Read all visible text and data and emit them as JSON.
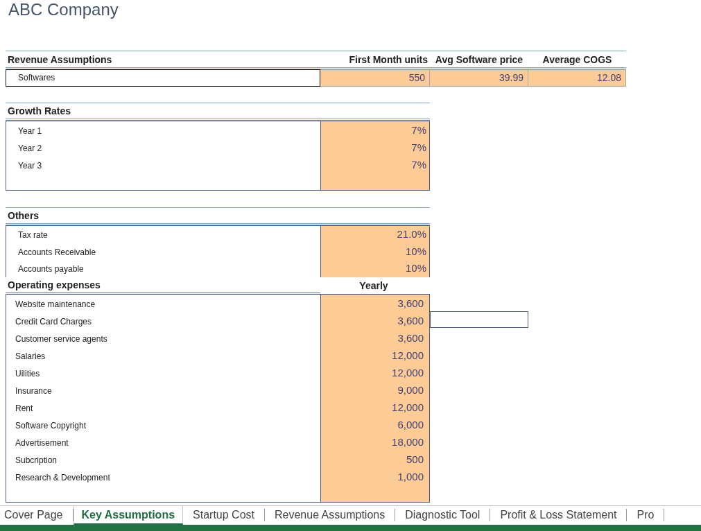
{
  "title": "ABC Company",
  "revenue": {
    "heading": "Revenue Assumptions",
    "columns": [
      "First Month units",
      "Avg Software price",
      "Average COGS"
    ],
    "rows": [
      {
        "label": "Softwares",
        "values": [
          "550",
          "39.99",
          "12.08"
        ]
      }
    ]
  },
  "growth": {
    "heading": "Growth Rates",
    "rows": [
      {
        "label": "Year 1",
        "value": "7%"
      },
      {
        "label": "Year 2",
        "value": "7%"
      },
      {
        "label": "Year 3",
        "value": "7%"
      }
    ]
  },
  "others": {
    "heading": "Others",
    "rows": [
      {
        "label": "Tax rate",
        "value": "21.0%"
      },
      {
        "label": "Accounts Receivable",
        "value": "10%"
      },
      {
        "label": "Accounts payable",
        "value": "10%"
      }
    ]
  },
  "opex": {
    "heading": "Operating expenses",
    "column": "Yearly",
    "rows": [
      {
        "label": "Website maintenance",
        "value": "3,600"
      },
      {
        "label": "Credit Card Charges",
        "value": "3,600"
      },
      {
        "label": "Customer service agents",
        "value": "3,600"
      },
      {
        "label": "Salaries",
        "value": "12,000"
      },
      {
        "label": "Uilities",
        "value": "12,000"
      },
      {
        "label": "Insurance",
        "value": "9,000"
      },
      {
        "label": "Rent",
        "value": "12,000"
      },
      {
        "label": "Software Copyright",
        "value": "6,000"
      },
      {
        "label": "Advertisement",
        "value": "18,000"
      },
      {
        "label": "Subcription",
        "value": "500"
      },
      {
        "label": "Research & Development",
        "value": "1,000"
      }
    ]
  },
  "sheet_tabs": [
    {
      "label": "Cover Page",
      "selected": false
    },
    {
      "label": "Key Assumptions",
      "selected": true
    },
    {
      "label": "Startup Cost",
      "selected": false
    },
    {
      "label": "Revenue Assumptions",
      "selected": false
    },
    {
      "label": "Diagnostic Tool",
      "selected": false
    },
    {
      "label": "Profit & Loss Statement",
      "selected": false
    },
    {
      "label": "Pro",
      "selected": false
    }
  ]
}
